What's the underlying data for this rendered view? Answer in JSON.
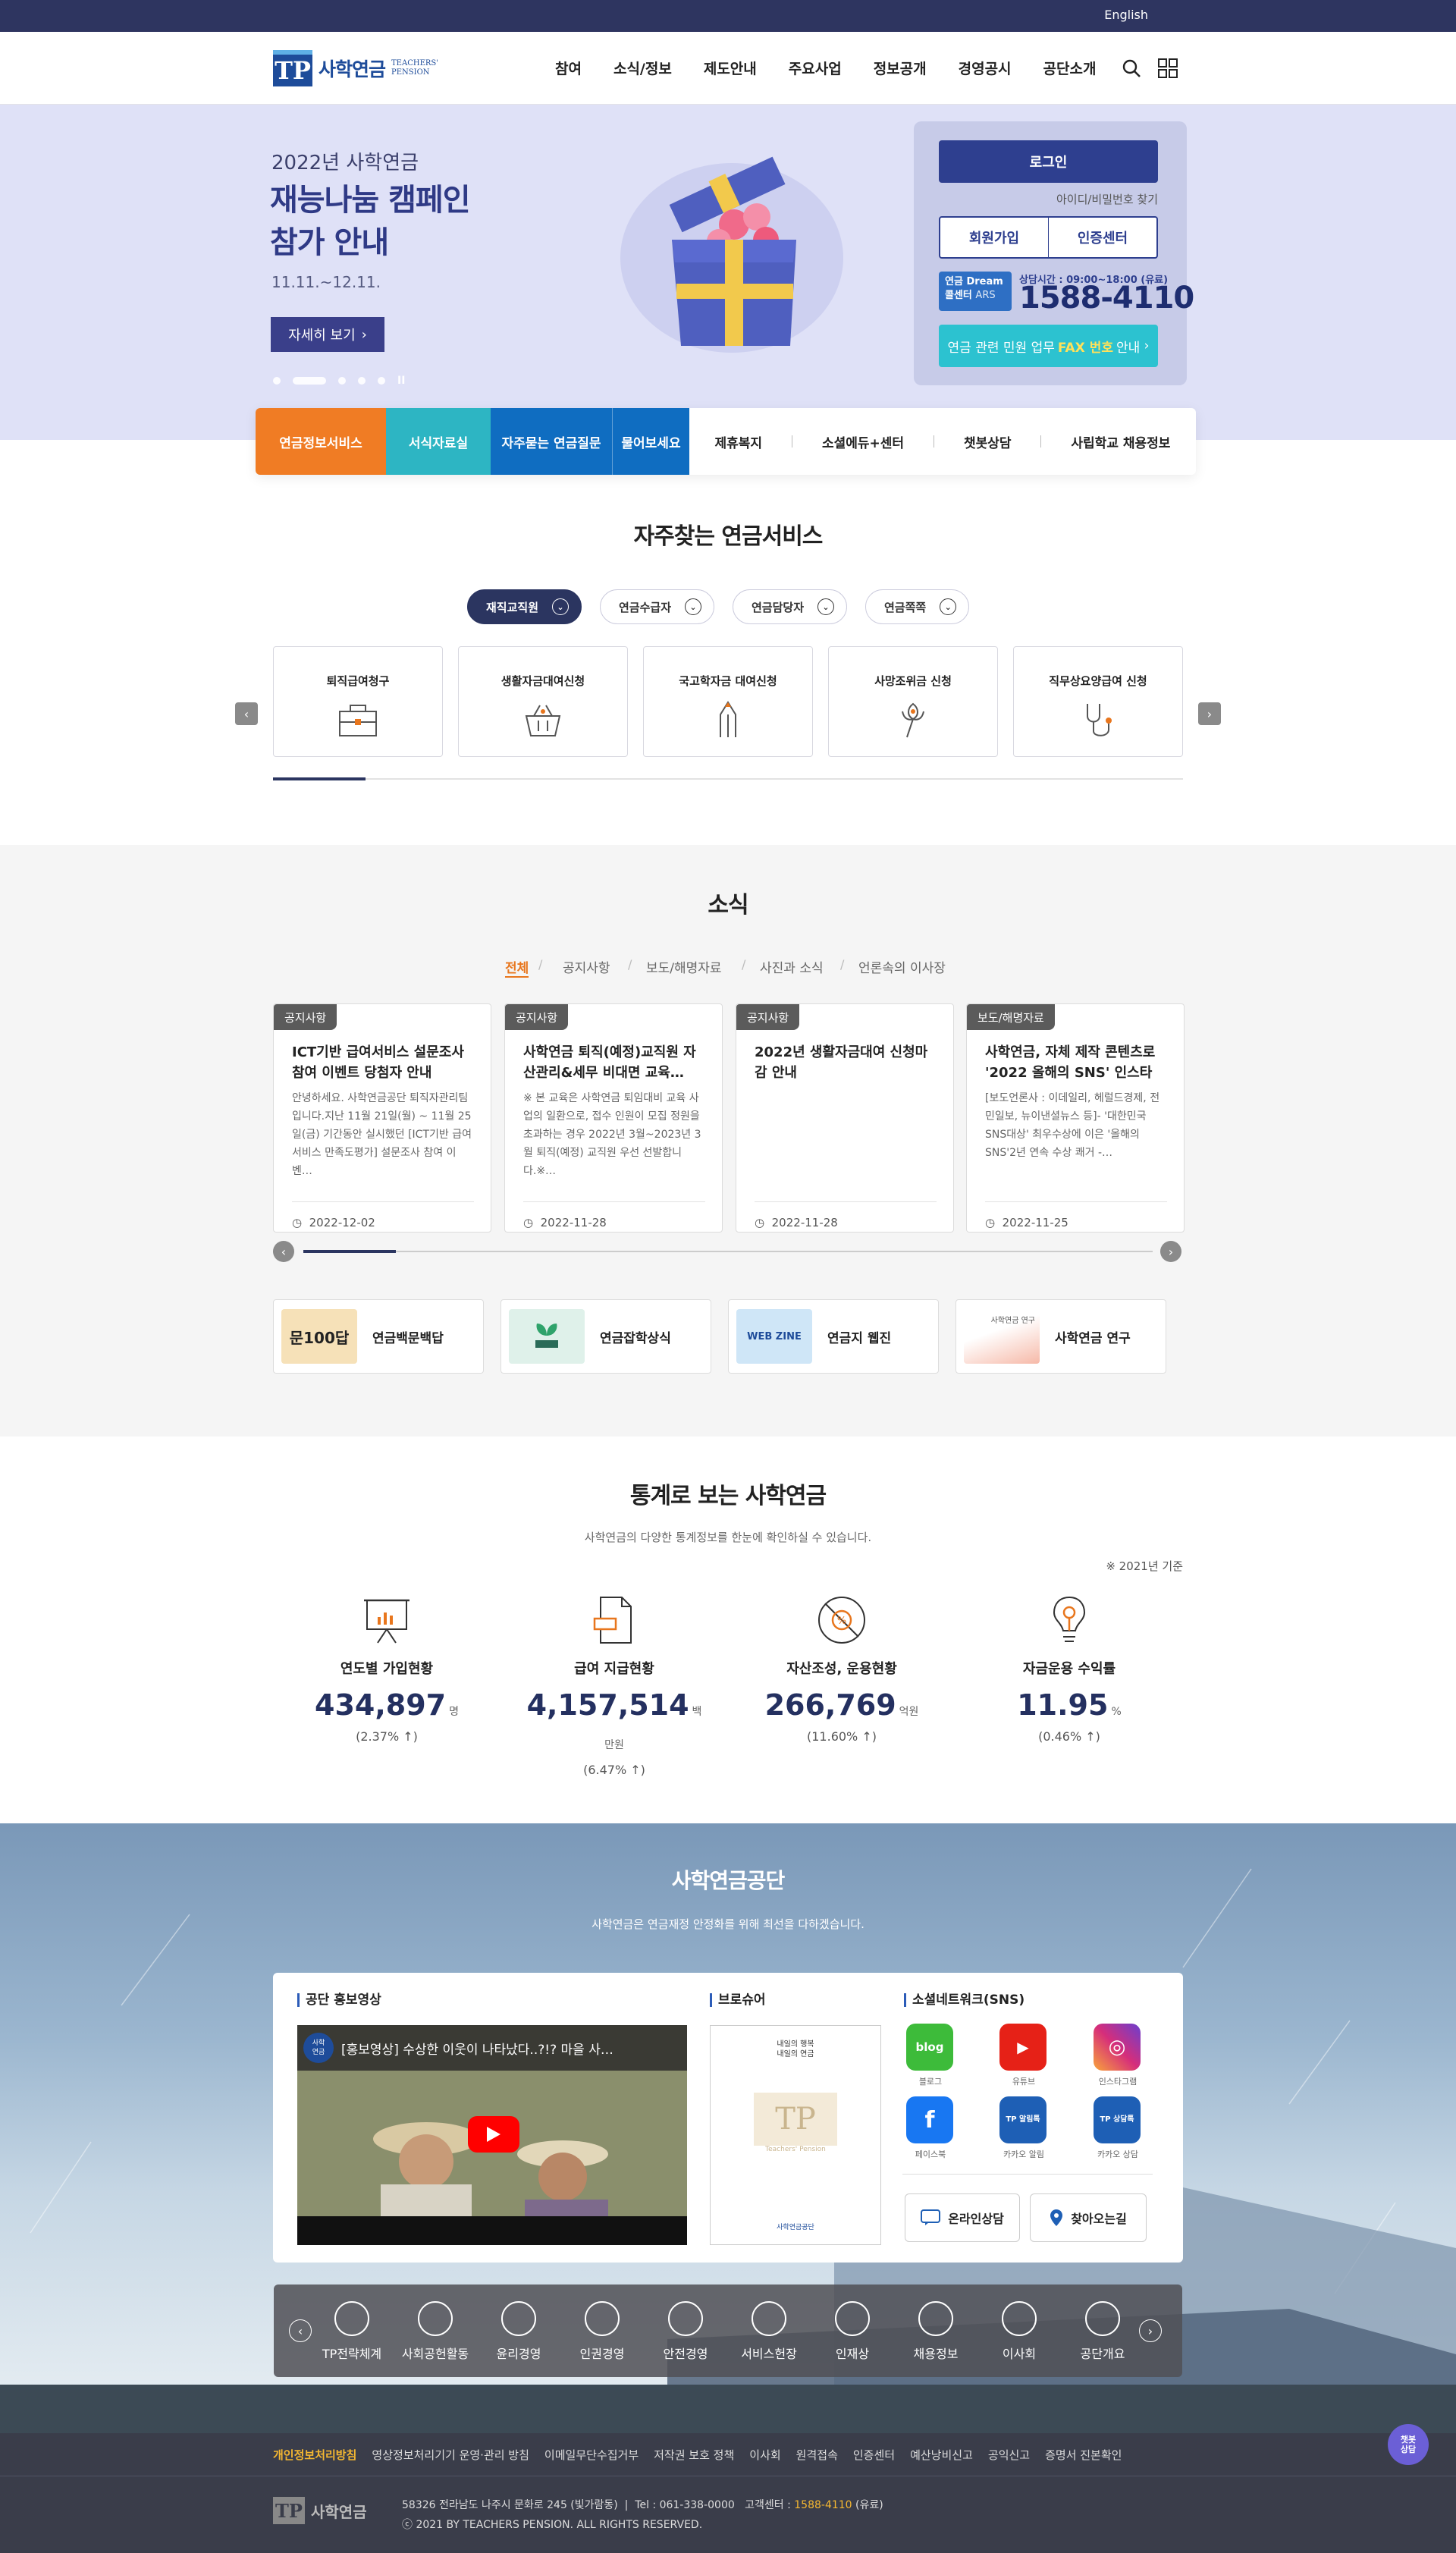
{
  "topbar": {
    "english": "English"
  },
  "header": {
    "logo_kr": "사학연금",
    "logo_en1": "TEACHERS'",
    "logo_en2": "PENSION",
    "logo_mark": "TP",
    "nav": [
      "참여",
      "소식/정보",
      "제도안내",
      "주요사업",
      "정보공개",
      "경영공시",
      "공단소개"
    ]
  },
  "hero": {
    "subtitle": "2022년 사학연금",
    "title_line1": "재능나눔 캠페인",
    "title_line2": "참가 안내",
    "date": "11.11.~12.11.",
    "button": "자세히 보기",
    "pause": "II"
  },
  "login": {
    "login_button": "로그인",
    "find": "아이디/비밀번호 찾기",
    "join": "회원가입",
    "cert": "인증센터",
    "dream_line1": "연금 Dream",
    "dream_line2": "콜센터",
    "dream_ars": "ARS",
    "hours": "상담시간 : 09:00~18:00 (유료)",
    "tel": "1588-4110",
    "fax_pre": "연금 관련 민원 업무",
    "fax_highlight": "FAX 번호",
    "fax_post": "안내"
  },
  "quick": {
    "q1": "연금정보서비스",
    "q2": "서식자료실",
    "q3": "자주묻는 연금질문",
    "q4": "물어보세요",
    "links": [
      "제휴복지",
      "소셜에듀+센터",
      "챗봇상담",
      "사립학교 채용정보"
    ]
  },
  "services": {
    "title": "자주찾는 연금서비스",
    "pills": [
      "재직교직원",
      "연금수급자",
      "연금담당자",
      "연금쪽쪽"
    ],
    "cards": [
      "퇴직급여청구",
      "생활자금대여신청",
      "국고학자금 대여신청",
      "사망조위금 신청",
      "직무상요양급여 신청"
    ]
  },
  "news": {
    "title": "소식",
    "tabs": [
      "전체",
      "공지사항",
      "보도/해명자료",
      "사진과 소식",
      "언론속의 이사장"
    ],
    "items": [
      {
        "badge": "공지사항",
        "title": "ICT기반 급여서비스 설문조사 참여 이벤트 당첨자 안내",
        "body": "안녕하세요. 사학연금공단 퇴직자관리팀입니다.지난 11월 21일(월) ~ 11월 25일(금) 기간동안 실시했던 [ICT기반 급여서비스 만족도평가] 설문조사 참여 이벤…",
        "date": "2022-12-02"
      },
      {
        "badge": "공지사항",
        "title": "사학연금 퇴직(예정)교직원 자산관리&세무 비대면 교육…",
        "body": "※ 본 교육은 사학연금 퇴임대비 교육 사업의 일환으로, 접수 인원이 모집 정원을 초과하는 경우 2022년 3월~2023년 3월 퇴직(예정) 교직원 우선 선발합니다.※…",
        "date": "2022-11-28"
      },
      {
        "badge": "공지사항",
        "title": "2022년 생활자금대여 신청마감 안내",
        "body": "",
        "date": "2022-11-28"
      },
      {
        "badge": "보도/해명자료",
        "title": "사학연금, 자체 제작 콘텐츠로 '2022 올해의 SNS' 인스타그…",
        "body": "[보도언론사 : 이데일리, 헤럴드경제, 전민일보, 뉴이낸셜뉴스 등]- '대한민국 SNS대상' 최우수상에 이은 '올해의 SNS'2년 연속 수상 쾌거 -…",
        "date": "2022-11-25"
      }
    ],
    "banners": [
      "연금백문백답",
      "연금잡학상식",
      "연금지 웹진",
      "사학연금 연구"
    ],
    "banner1_img": "문100답",
    "banner3_img": "WEB ZINE",
    "banner4_img": "사학연금 연구"
  },
  "stats": {
    "title": "통계로 보는 사학연금",
    "desc": "사학연금의 다양한 통계정보를 한눈에 확인하실 수 있습니다.",
    "basis": "※ 2021년 기준",
    "items": [
      {
        "name": "연도별 가입현황",
        "value": "434,897",
        "unit": "명",
        "change": "(2.37% ↑)"
      },
      {
        "name": "급여 지급현황",
        "value": "4,157,514",
        "unit": "백만원",
        "change": "(6.47% ↑)"
      },
      {
        "name": "자산조성, 운용현황",
        "value": "266,769",
        "unit": "억원",
        "change": "(11.60% ↑)"
      },
      {
        "name": "자금운용 수익률",
        "value": "11.95",
        "unit": "%",
        "change": "(0.46% ↑)"
      }
    ]
  },
  "foundation": {
    "title": "사학연금공단",
    "desc": "사학연금은 연금재정 안정화를 위해 최선을 다하겠습니다.",
    "video_head": "공단 홍보영상",
    "video_title": "[홍보영상] 수상한 이웃이 나타났다..?!? 마을 사…",
    "video_channel_line1": "사학",
    "video_channel_line2": "연금",
    "brochure_head": "브로슈어",
    "brochure_top_line1": "내일의 행복",
    "brochure_top_line2": "내일의 연금",
    "brochure_mark": "TP",
    "brochure_name": "Teachers' Pension",
    "brochure_footer": "사학연금공단",
    "sns_head": "소셜네트워크(SNS)",
    "sns": [
      "블로그",
      "유튜브",
      "인스타그램",
      "페이스북",
      "카카오 알림",
      "카카오 상담"
    ],
    "sns_icon_text": [
      "blog",
      "▶",
      "◎",
      "f",
      "TP 알림톡",
      "TP 상담톡"
    ],
    "online": "온라인상담",
    "directions": "찾아오는길",
    "mgmt": [
      "TP전략체계",
      "사회공헌활동",
      "윤리경영",
      "인권경영",
      "안전경영",
      "서비스헌장",
      "인재상",
      "채용정보",
      "이사회",
      "공단개요"
    ]
  },
  "footer": {
    "links": [
      "개인정보처리방침",
      "영상정보처리기기 운영·관리 방침",
      "이메일무단수집거부",
      "저작권 보호 정책",
      "이사회",
      "원격접속",
      "인증센터",
      "예산낭비신고",
      "공익신고",
      "증명서 진본확인"
    ],
    "logo": "사학연금",
    "logo_mark": "TP",
    "addr": "58326 전라남도 나주시 문화로 245 (빛가람동)",
    "tel": "Tel : 061-338-0000",
    "callcenter_label": "고객센터 :",
    "callcenter": "1588-4110",
    "paid": "(유료)",
    "copyright": "ⓒ 2021 BY TEACHERS PENSION. ALL RIGHTS RESERVED.",
    "chatbot_line1": "챗봇",
    "chatbot_line2": "상담"
  },
  "colors": {
    "brand_navy": "#2e3560",
    "orange": "#f07c24",
    "teal": "#2db5c3",
    "blue": "#0f6dc1",
    "accent_yellow": "#f4b731"
  }
}
